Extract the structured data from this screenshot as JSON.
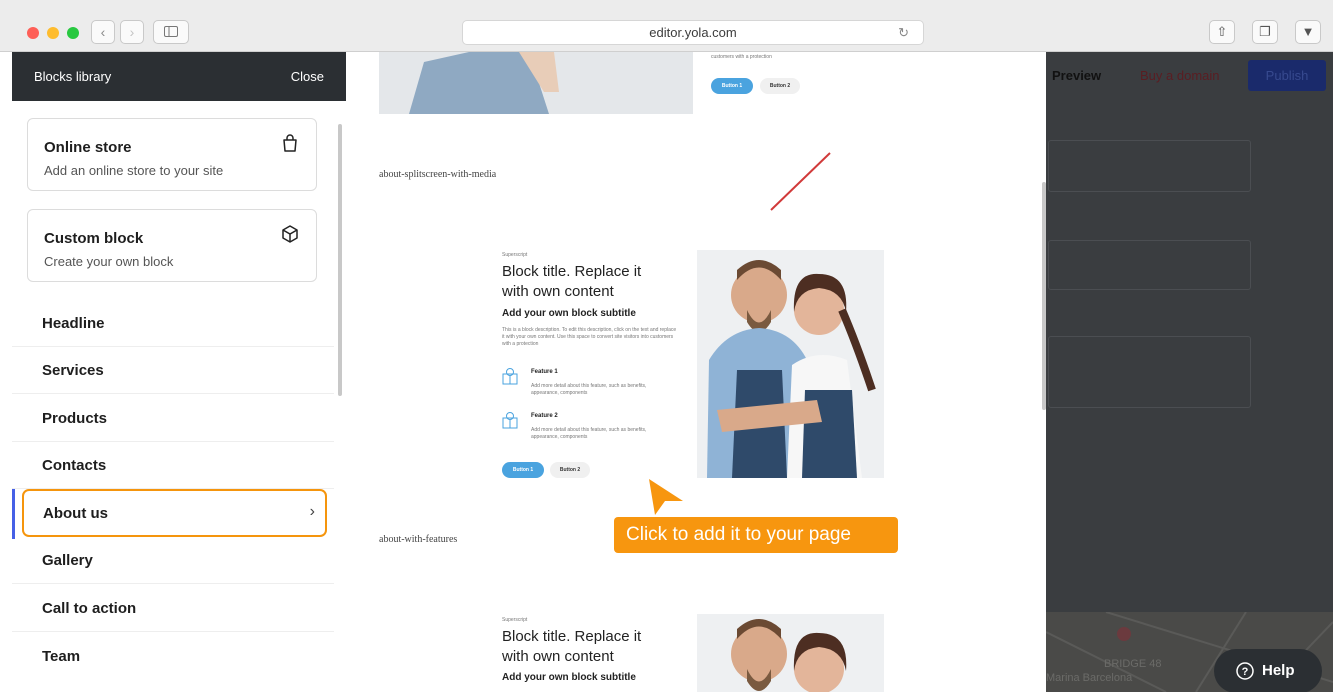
{
  "browser": {
    "url": "editor.yola.com",
    "traffic_colors": [
      "#fe5f57",
      "#febc2e",
      "#28c840"
    ]
  },
  "sidebar": {
    "title": "Blocks library",
    "close_label": "Close",
    "cards": [
      {
        "title": "Online store",
        "desc": "Add an online store to your site",
        "icon": "shopping-bag-icon"
      },
      {
        "title": "Custom block",
        "desc": "Create your own block",
        "icon": "cube-icon"
      }
    ],
    "items": [
      {
        "label": "Headline"
      },
      {
        "label": "Services"
      },
      {
        "label": "Products"
      },
      {
        "label": "Contacts"
      },
      {
        "label": "About us",
        "selected": true
      },
      {
        "label": "Gallery"
      },
      {
        "label": "Call to action"
      },
      {
        "label": "Team"
      }
    ],
    "accent_color": "#f5950d"
  },
  "preview": {
    "top_block": {
      "small_text": "customers with a protection",
      "button1": "Button 1",
      "button2": "Button 2"
    },
    "block1_label": "about-splitscreen-with-media",
    "block2": {
      "superscript": "Superscript",
      "title_line1": "Block title. Replace it",
      "title_line2": "with own content",
      "subtitle": "Add your own block subtitle",
      "desc": "This is a block description. To edit this description, click on the text and replace it with your own content. Use this space to convert site visitors into customers with a protection",
      "feature1_title": "Feature 1",
      "feature1_desc": "Add more detail about this feature, such as benefits, appearance, components",
      "feature2_title": "Feature 2",
      "feature2_desc": "Add more detail about this feature, such as benefits, appearance, components",
      "button1": "Button 1",
      "button2": "Button 2"
    },
    "block2_label": "about-with-features",
    "block3": {
      "superscript": "Superscript",
      "title_line1": "Block title. Replace it",
      "title_line2": "with own content",
      "subtitle": "Add your own block subtitle"
    },
    "callout": "Click to add it to your page",
    "button_color": "#4aa3df"
  },
  "right": {
    "preview_label": "Preview",
    "buy_domain_label": "Buy a domain",
    "publish_label": "Publish",
    "map_label1": "BRIDGE 48",
    "map_label2": "Marina Barcelona",
    "help_label": "Help"
  }
}
